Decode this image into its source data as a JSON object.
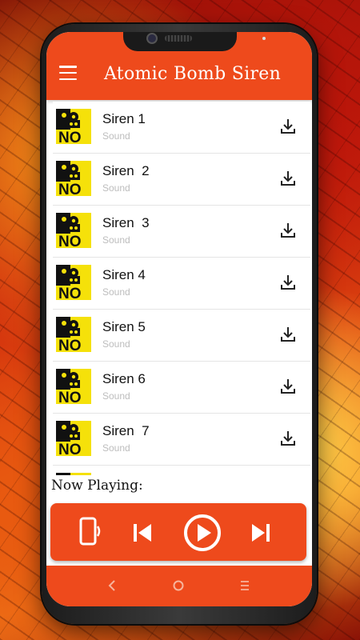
{
  "app": {
    "title": "Atomic Bomb Siren"
  },
  "list": {
    "items": [
      {
        "title": "Siren 1",
        "subtitle": "Sound"
      },
      {
        "title": "Siren  2",
        "subtitle": "Sound"
      },
      {
        "title": "Siren  3",
        "subtitle": "Sound"
      },
      {
        "title": "Siren 4",
        "subtitle": "Sound"
      },
      {
        "title": "Siren 5",
        "subtitle": "Sound"
      },
      {
        "title": "Siren 6",
        "subtitle": "Sound"
      },
      {
        "title": "Siren  7",
        "subtitle": "Sound"
      }
    ]
  },
  "player": {
    "now_playing_label": "Now Playing:"
  },
  "icons": {
    "menu": "hamburger-menu-icon",
    "download": "download-icon",
    "device": "phone-vibrate-icon",
    "previous": "skip-previous-icon",
    "play": "play-circle-icon",
    "next": "skip-next-icon",
    "back": "back-chevron-icon",
    "home": "home-circle-icon",
    "recents": "recents-lines-icon"
  },
  "colors": {
    "accent": "#ee4a1c",
    "thumb_yellow": "#f5e10a",
    "thumb_black": "#111111"
  }
}
